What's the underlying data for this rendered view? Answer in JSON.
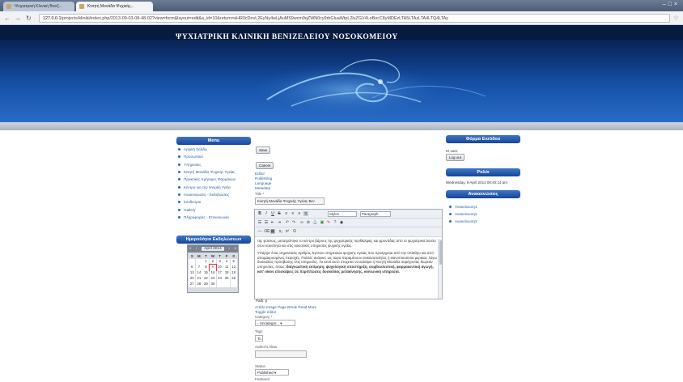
{
  "browser": {
    "tabs": [
      {
        "label": "Ψυχιατρική Κλινική Βενιζ..."
      },
      {
        "label": "Κινητή Μονάδα Ψυχικής..."
      }
    ],
    "url_host": "127.0.0.1",
    "url_path": "/projects/kliniki/index.php/2013-09-03-08-48-02?view=form&layout=edit&a_id=10&return=aHR0cDovL2EyNy4wLjAuMS9wcm9qZWN0cy9rbGluaWtpL2luZGV4LnBocC8yMDEzLTA5LTAzLTA4LTQ4LTAy"
  },
  "site": {
    "title": "ΨΥΧΙΑΤΡΙΚΗ ΚΛΙΝΙΚΗ ΒΕΝΙΖΕΛΕΙΟΥ ΝΟΣΟΚΟΜΕΙΟΥ"
  },
  "menu": {
    "heading": "Menu",
    "items": [
      {
        "label": "Αρχική Σελίδα"
      },
      {
        "label": "Προσωπικό"
      },
      {
        "label": "Υπηρεσίες"
      },
      {
        "label": "Κινητή Μονάδα Ψυχικής Υγείας"
      },
      {
        "label": "Πρακτικές Χρήσιμες Φαρμάκων"
      },
      {
        "label": "Κέντρα για την Ψυχική Υγεία"
      },
      {
        "label": "Ανακοινώσεις - Εκδηλώσεις"
      },
      {
        "label": "Σύνδεσμοι"
      },
      {
        "label": "Gallery"
      },
      {
        "label": "Πληροφορίες - Επικοινωνία"
      }
    ]
  },
  "calendar": {
    "heading": "Ημερολόγιο Εκδηλώσεων",
    "month": "April 2014",
    "day_headers": [
      "S",
      "M",
      "T",
      "W",
      "T",
      "F",
      "S"
    ],
    "days": [
      "",
      "",
      "1",
      "2",
      "3",
      "4",
      "5",
      "6",
      "7",
      "8",
      "9",
      "10",
      "11",
      "12",
      "13",
      "14",
      "15",
      "16",
      "17",
      "18",
      "19",
      "20",
      "21",
      "22",
      "23",
      "24",
      "25",
      "26",
      "27",
      "28",
      "29",
      "30",
      "",
      "",
      ""
    ],
    "today": "9"
  },
  "form": {
    "save_label": "Save",
    "cancel_label": "Cancel",
    "tabs": [
      "Editor",
      "Publishing",
      "Language",
      "Metadata"
    ],
    "title_label": "Title *",
    "title_value": "Κινητή Μονάδα Ψυχικής Υγείας Βεν",
    "styles_select": "Styles",
    "paragraph_select": "Paragraph",
    "content_p1": "της φύσεως, μετατράπηκε το κέντρο βάρους της ψυχιατρικής περίθαλψης και φροντίδας από το ψυχιατρικό άσυλο στον κοινότητα και στις κοινοτικές υπηρεσίες ψυχικής υγείας.",
    "content_p2": "Υπάρχει ένας σημαντικός αριθμός ληπτών υπηρεσιών ψυχικής υγείας που προέρχεται από την ύπαιθρο και από απομακρυσμένες περιοχές. Πολλές ανάγκες ως τώρα παραμένουν ανικανοποίητες ή ικανοποιούνται μερικώς λόγω δυσκολίας πρόσβασης στις υπηρεσίες. Το κενό αυτό στοχεύει να καλύψει η Κινητή Μονάδα παρέχοντας δωρεάν υπηρεσίες, όπως:",
    "content_bold": "διαγνωστική εκτίμηση, ψυχολογική υποστήριξη, συμβουλευτική, φαρμακευτική αγωγή, κατ' οίκον επισκέψεις σε περιπτώσεις δυσκολίας μετακίνησης, κοινωνική υπηρεσία.",
    "path": "Path: p",
    "editor_buttons": "Article   Image   Page Break   Read More",
    "toggle_editor": "Toggle editor",
    "category_label": "Category *",
    "category_value": "- Uncategor...",
    "tags_label": "Tags",
    "tags_value": "To",
    "authors_alias_label": "Author's Alias",
    "status_label": "Status",
    "status_value": "Published",
    "featured_label": "Featured"
  },
  "login": {
    "heading": "Φόρμα Εισόδου",
    "username_label": "Hi user,",
    "logout_label": "Log out"
  },
  "clock": {
    "heading": "Ρολόι",
    "datetime": "Wednesday, 9 April 2014 09:40:14 am"
  },
  "announcements": {
    "heading": "Ανακοινώσεις",
    "items": [
      {
        "label": "Ανακοίνωση1"
      },
      {
        "label": "Ανακοίνωση2"
      },
      {
        "label": "Ανακοίνωση3"
      }
    ]
  }
}
